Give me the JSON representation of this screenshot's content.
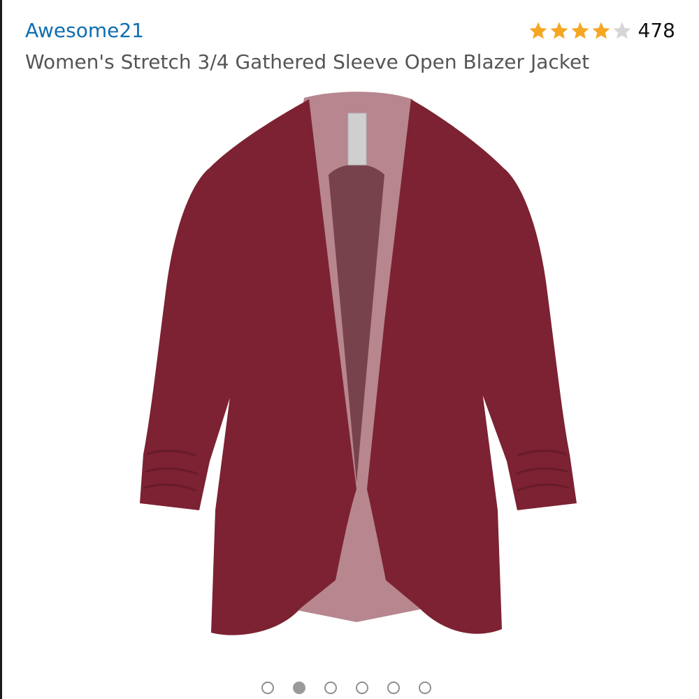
{
  "header": {
    "brand": "Awesome21",
    "product_title": "Women's Stretch 3/4 Gathered Sleeve Open Blazer Jacket"
  },
  "rating": {
    "stars": 4,
    "max_stars": 5,
    "review_count": "478",
    "star_color": "#f5a623",
    "empty_star_color": "#d6d6d6"
  },
  "image": {
    "subject": "burgundy-open-blazer-jacket",
    "color": "#7c2232"
  },
  "carousel": {
    "total": 6,
    "active_index": 1
  }
}
